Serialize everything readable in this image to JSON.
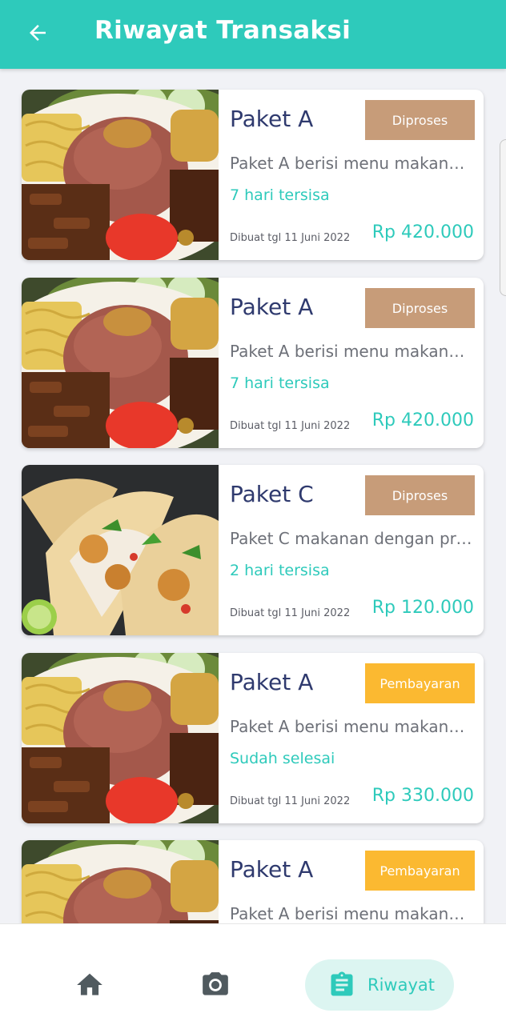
{
  "header": {
    "title": "Riwayat Transaksi",
    "back_icon": "arrow-left-icon",
    "color": "#2ecabb"
  },
  "transactions": [
    {
      "title": "Paket A",
      "status": "Diproses",
      "status_color": "#c79c79",
      "description": "Paket A berisi menu makanan sehat",
      "remaining": "7 hari tersisa",
      "created": "Dibuat tgl 11 Juni 2022",
      "price": "Rp 420.000",
      "image": "rice-plate"
    },
    {
      "title": "Paket A",
      "status": "Diproses",
      "status_color": "#c79c79",
      "description": "Paket A berisi menu makanan sehat",
      "remaining": "7 hari tersisa",
      "created": "Dibuat tgl 11 Juni 2022",
      "price": "Rp 420.000",
      "image": "rice-plate"
    },
    {
      "title": "Paket C",
      "status": "Diproses",
      "status_color": "#c79c79",
      "description": "Paket C makanan dengan protein",
      "remaining": "2 hari tersisa",
      "created": "Dibuat tgl 11 Juni 2022",
      "price": "Rp 120.000",
      "image": "tacos"
    },
    {
      "title": "Paket A",
      "status": "Pembayaran",
      "status_color": "#fbb931",
      "description": "Paket A berisi menu makanan sehat",
      "remaining": "Sudah selesai",
      "created": "Dibuat tgl 11 Juni 2022",
      "price": "Rp 330.000",
      "image": "rice-plate"
    },
    {
      "title": "Paket A",
      "status": "Pembayaran",
      "status_color": "#fbb931",
      "description": "Paket A berisi menu makanan sehat",
      "remaining": "",
      "created": "",
      "price": "",
      "image": "rice-plate"
    }
  ],
  "bottom_nav": {
    "items": [
      {
        "icon": "home-icon",
        "label": ""
      },
      {
        "icon": "camera-icon",
        "label": ""
      },
      {
        "icon": "clipboard-icon",
        "label": "Riwayat",
        "active": true
      }
    ],
    "active_bg": "#dcf5f1"
  }
}
